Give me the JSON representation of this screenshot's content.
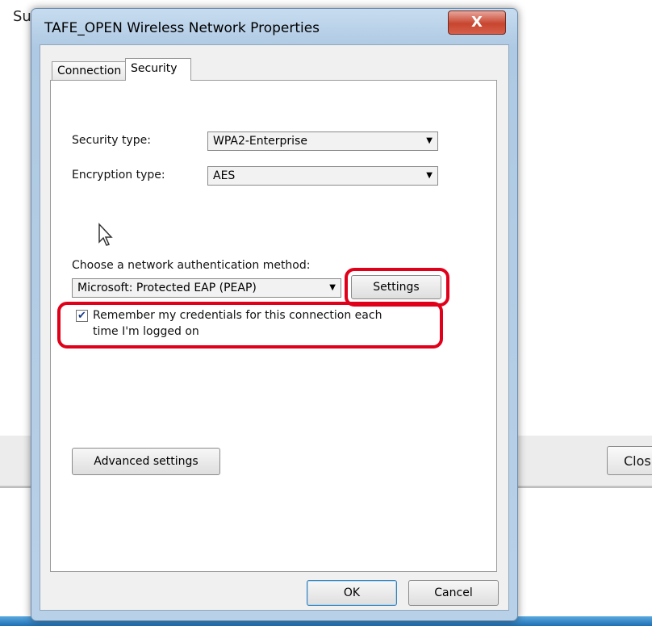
{
  "background": {
    "partial_title": "Su",
    "close_button_label": "Clos"
  },
  "dialog": {
    "title": "TAFE_OPEN Wireless Network Properties",
    "close_glyph": "X",
    "tabs": [
      {
        "label": "Connection"
      },
      {
        "label": "Security"
      }
    ],
    "security_type_label": "Security type:",
    "security_type_value": "WPA2-Enterprise",
    "encryption_type_label": "Encryption type:",
    "encryption_type_value": "AES",
    "auth_method_label": "Choose a network authentication method:",
    "auth_method_value": "Microsoft: Protected EAP (PEAP)",
    "settings_button": "Settings",
    "remember_line1": "Remember my credentials for this connection each",
    "remember_line2": "time I'm logged on",
    "advanced_button": "Advanced settings",
    "ok_button": "OK",
    "cancel_button": "Cancel"
  },
  "colors": {
    "highlight": "#e0001a",
    "close_button": "#c7452f"
  },
  "icons": [
    "close-icon",
    "dropdown-arrow-icon",
    "checkmark-icon",
    "mouse-cursor-icon"
  ]
}
